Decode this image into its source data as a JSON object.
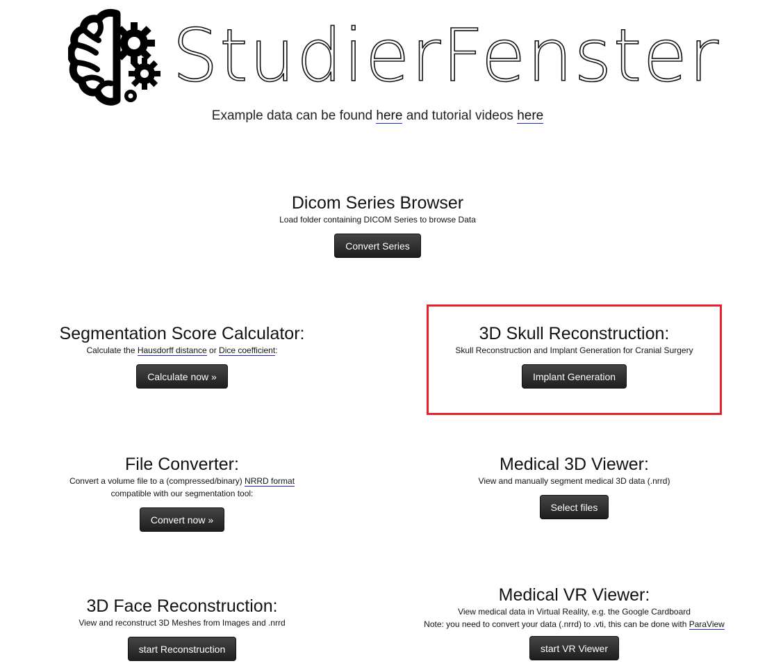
{
  "header": {
    "logo_text": "StudierFenster",
    "intro_prefix": "Example data can be found ",
    "intro_link1": "here",
    "intro_middle": " and tutorial videos ",
    "intro_link2": "here"
  },
  "tools": {
    "dicom": {
      "title": "Dicom Series Browser",
      "desc": "Load folder containing DICOM Series to browse Data",
      "button": "Convert Series"
    },
    "segscore": {
      "title": "Segmentation Score Calculator:",
      "desc_prefix": "Calculate the ",
      "desc_link1": "Hausdorff distance",
      "desc_middle": " or ",
      "desc_link2": "Dice coefficient",
      "desc_suffix": ":",
      "button": "Calculate now »"
    },
    "skull": {
      "title": "3D Skull Reconstruction:",
      "desc": "Skull Reconstruction and Implant Generation for Cranial Surgery",
      "button": "Implant Generation"
    },
    "converter": {
      "title": "File Converter:",
      "desc_prefix": "Convert a volume file to a (compressed/binary) ",
      "desc_link": "NRRD format",
      "desc_line2": "compatible with our segmentation tool:",
      "button": "Convert now »"
    },
    "viewer3d": {
      "title": "Medical 3D Viewer:",
      "desc": "View and manually segment medical 3D data (.nrrd)",
      "button": "Select files"
    },
    "face": {
      "title": "3D Face Reconstruction:",
      "desc": "View and reconstruct 3D Meshes from Images and .nrrd",
      "button": "start Reconstruction"
    },
    "vr": {
      "title": "Medical VR Viewer:",
      "desc_line1": "View medical data in Virtual Reality, e.g. the Google Cardboard",
      "desc_line2_prefix": "Note: you need to convert your data (.nrrd) to .vti, this can be done with ",
      "desc_link": "ParaView",
      "button": "start VR Viewer"
    }
  },
  "colors": {
    "highlight_border": "#e8202a",
    "link_underline": "#2222cc",
    "button_bg": "#2b2b2b"
  },
  "icons": {
    "logo": "brain-gears-icon"
  }
}
